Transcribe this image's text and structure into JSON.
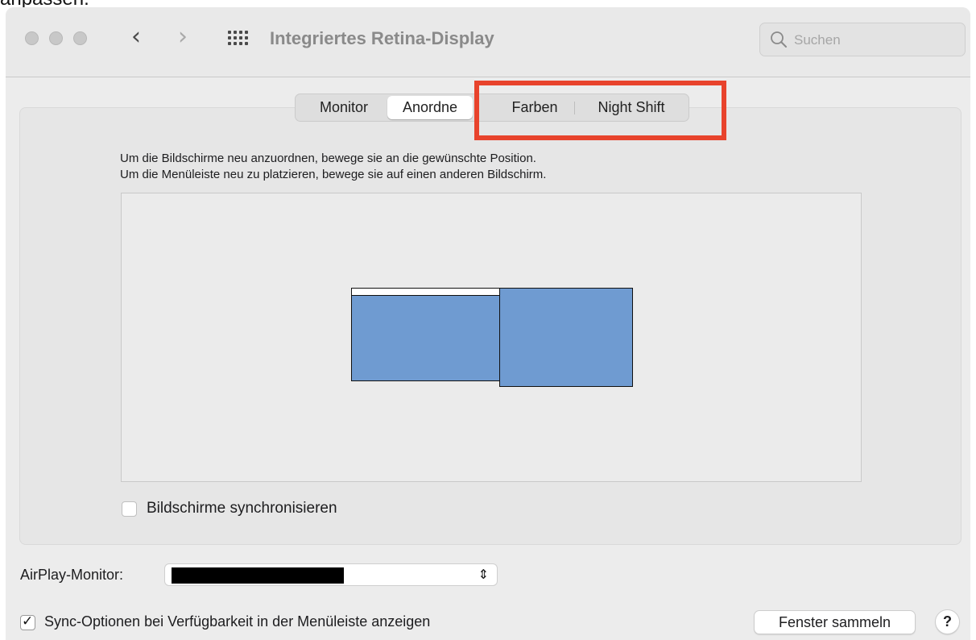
{
  "top_fragment": "anpassen.",
  "window": {
    "title": "Integriertes Retina-Display",
    "nav": {
      "back_icon": "chevron-left-icon",
      "forward_icon": "chevron-right-icon",
      "grid_icon": "show-all-grid-icon"
    },
    "search": {
      "placeholder": "Suchen",
      "value": ""
    }
  },
  "tabs": [
    {
      "label": "Monitor",
      "active": false
    },
    {
      "label": "Anordne",
      "active": true
    },
    {
      "label": "Farben",
      "active": false
    },
    {
      "label": "Night Shift",
      "active": false
    }
  ],
  "highlight": {
    "color": "#e8432c"
  },
  "instructions": {
    "line1": "Um die Bildschirme neu anzuordnen, bewege sie an die gewünschte Position.",
    "line2": "Um die Menüleiste neu zu platzieren, bewege sie auf einen anderen Bildschirm."
  },
  "displays": {
    "color": "#6f9bd1",
    "main": {
      "has_menubar": true
    },
    "secondary": {
      "has_menubar": false
    }
  },
  "mirror_checkbox": {
    "label": "Bildschirme synchronisieren",
    "checked": false
  },
  "airplay": {
    "label": "AirPlay-Monitor:",
    "value_redacted": true
  },
  "sync_options": {
    "label": "Sync-Optionen bei Verfügbarkeit in der Menüleiste anzeigen",
    "checked": true
  },
  "buttons": {
    "gather_windows": "Fenster sammeln",
    "help": "?"
  }
}
